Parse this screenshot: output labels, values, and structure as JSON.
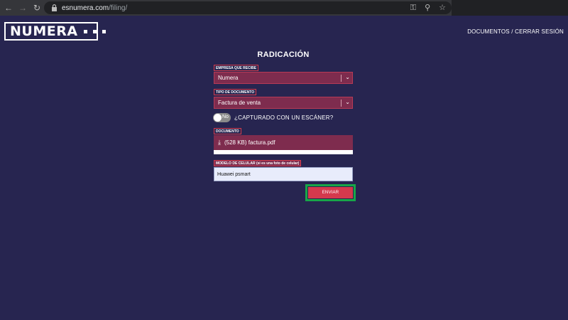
{
  "browser": {
    "url_domain": "esnumera.com",
    "url_path": "/filing/"
  },
  "header": {
    "logo_text": "NUMERA",
    "link_documents": "DOCUMENTOS",
    "link_separator": "/",
    "link_logout": "CERRAR SESIÓN"
  },
  "form": {
    "title": "RADICACIÓN",
    "company_label": "EMPRESA QUE RECIBE",
    "company_value": "Numera",
    "doc_type_label": "TIPO DE DOCUMENTO",
    "doc_type_value": "Factura de venta",
    "toggle_value": "No",
    "scanner_question": "¿CAPTURADO CON UN ESCÁNER?",
    "document_label": "DOCUMENTO",
    "file_value": "(528 KB) factura.pdf",
    "phone_label": "MODELO DE CELULAR (si es una foto de celular)",
    "phone_value": "Huawei psmart",
    "submit_label": "ENVIAR"
  },
  "colors": {
    "background": "#272550",
    "field_fill": "#7e2c4e",
    "accent": "#d5394d",
    "highlight": "#17a648"
  }
}
